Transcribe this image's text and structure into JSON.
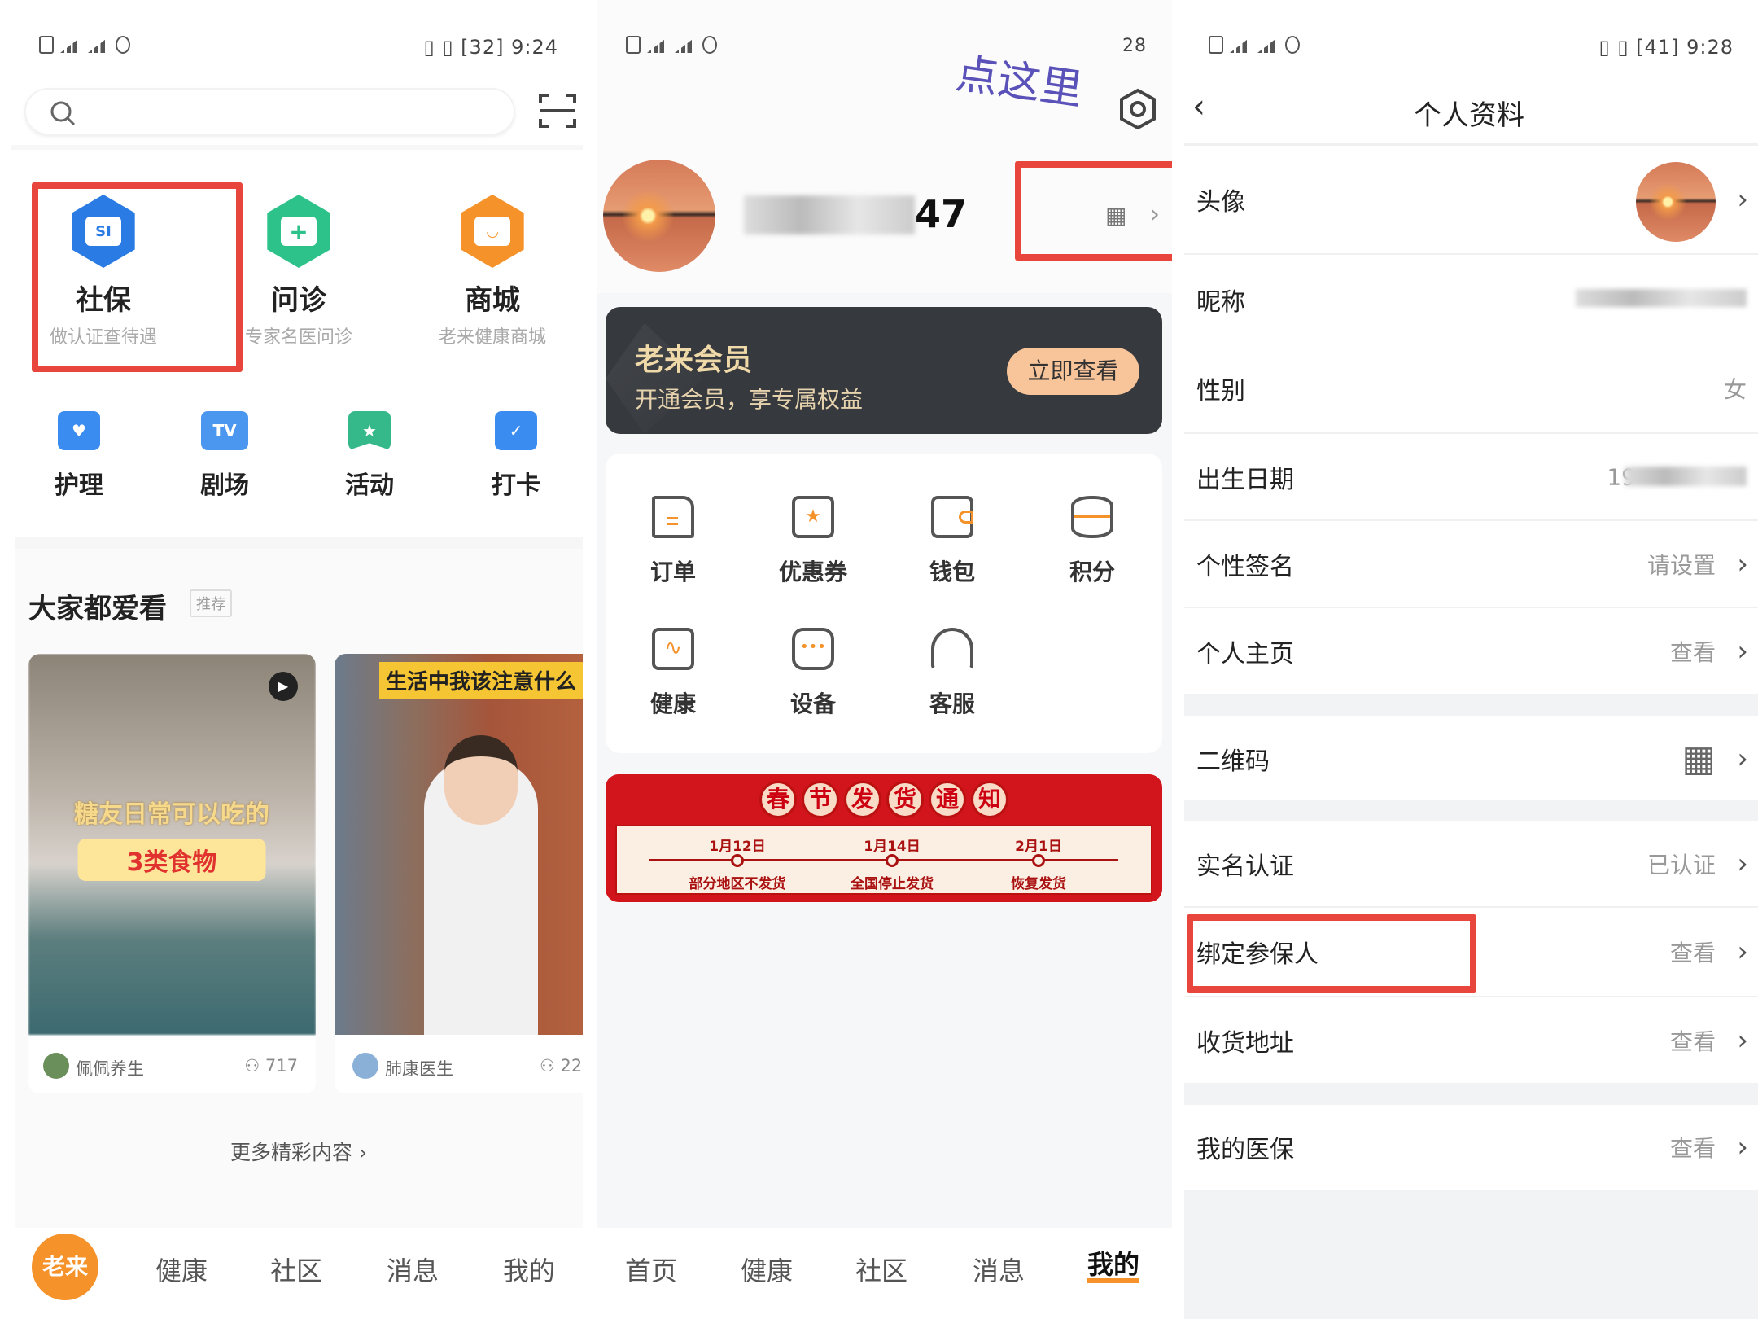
{
  "panel1": {
    "status": {
      "time": "9:24",
      "battery": "32"
    },
    "shortcuts_main": [
      {
        "label": "社保",
        "sub": "做认证查待遇",
        "icon": "social-security-icon",
        "icon_text": "SI",
        "color": "#2a7be4"
      },
      {
        "label": "问诊",
        "sub": "专家名医问诊",
        "icon": "doctor-icon",
        "icon_text": "+",
        "color": "#2ec28b"
      },
      {
        "label": "商城",
        "sub": "老来健康商城",
        "icon": "shopping-bag-icon",
        "icon_text": "◡",
        "color": "#f5922a"
      }
    ],
    "shortcuts_small": [
      {
        "label": "护理",
        "icon": "care-icon",
        "icon_text": "♥"
      },
      {
        "label": "剧场",
        "icon": "tv-icon",
        "icon_text": "TV"
      },
      {
        "label": "活动",
        "icon": "activity-icon",
        "icon_text": "★"
      },
      {
        "label": "打卡",
        "icon": "checkin-calendar-icon",
        "icon_text": "✓"
      }
    ],
    "section_title": "大家都爱看",
    "section_tag": "推荐",
    "videos": [
      {
        "overlay1": "糖友日常可以吃的",
        "overlay2": "3类食物",
        "author": "佩佩养生",
        "views": "717"
      },
      {
        "overlay1": "生活中我该注意什么",
        "author": "肺康医生",
        "views": "22"
      }
    ],
    "more_link": "更多精彩内容",
    "nav": {
      "logo": "老来",
      "items": [
        "健康",
        "社区",
        "消息",
        "我的"
      ]
    }
  },
  "panel2": {
    "status": {
      "time": "28"
    },
    "annotation": "点这里",
    "username_suffix": "47",
    "member": {
      "title": "老来会员",
      "subtitle": "开通会员，享专属权益",
      "button": "立即查看"
    },
    "grid": [
      {
        "label": "订单",
        "icon": "order-icon"
      },
      {
        "label": "优惠券",
        "icon": "coupon-icon"
      },
      {
        "label": "钱包",
        "icon": "wallet-icon"
      },
      {
        "label": "积分",
        "icon": "points-icon"
      },
      {
        "label": "健康",
        "icon": "health-icon"
      },
      {
        "label": "设备",
        "icon": "device-icon"
      },
      {
        "label": "客服",
        "icon": "customer-service-icon"
      }
    ],
    "banner": {
      "title_chars": [
        "春",
        "节",
        "发",
        "货",
        "通",
        "知"
      ],
      "milestones": [
        {
          "date": "1月12日",
          "text": "部分地区不发货"
        },
        {
          "date": "1月14日",
          "text": "全国停止发货"
        },
        {
          "date": "2月1日",
          "text": "恢复发货"
        }
      ]
    },
    "nav": {
      "items": [
        "首页",
        "健康",
        "社区",
        "消息",
        "我的"
      ],
      "active": "我的"
    }
  },
  "panel3": {
    "status": {
      "time": "9:28",
      "battery": "41"
    },
    "title": "个人资料",
    "rows": [
      {
        "label": "头像"
      },
      {
        "label": "昵称"
      },
      {
        "label": "性别",
        "value": "女"
      },
      {
        "label": "出生日期",
        "value": "19"
      },
      {
        "label": "个性签名",
        "value": "请设置"
      },
      {
        "label": "个人主页",
        "value": "查看"
      },
      {
        "label": "二维码"
      },
      {
        "label": "实名认证",
        "value": "已认证"
      },
      {
        "label": "绑定参保人",
        "value": "查看"
      },
      {
        "label": "收货地址",
        "value": "查看"
      },
      {
        "label": "我的医保",
        "value": "查看"
      }
    ]
  },
  "colors": {
    "accent": "#f5922a",
    "highlight": "#e8453c",
    "member_bg": "#36393d",
    "banner_red": "#d2141c"
  }
}
